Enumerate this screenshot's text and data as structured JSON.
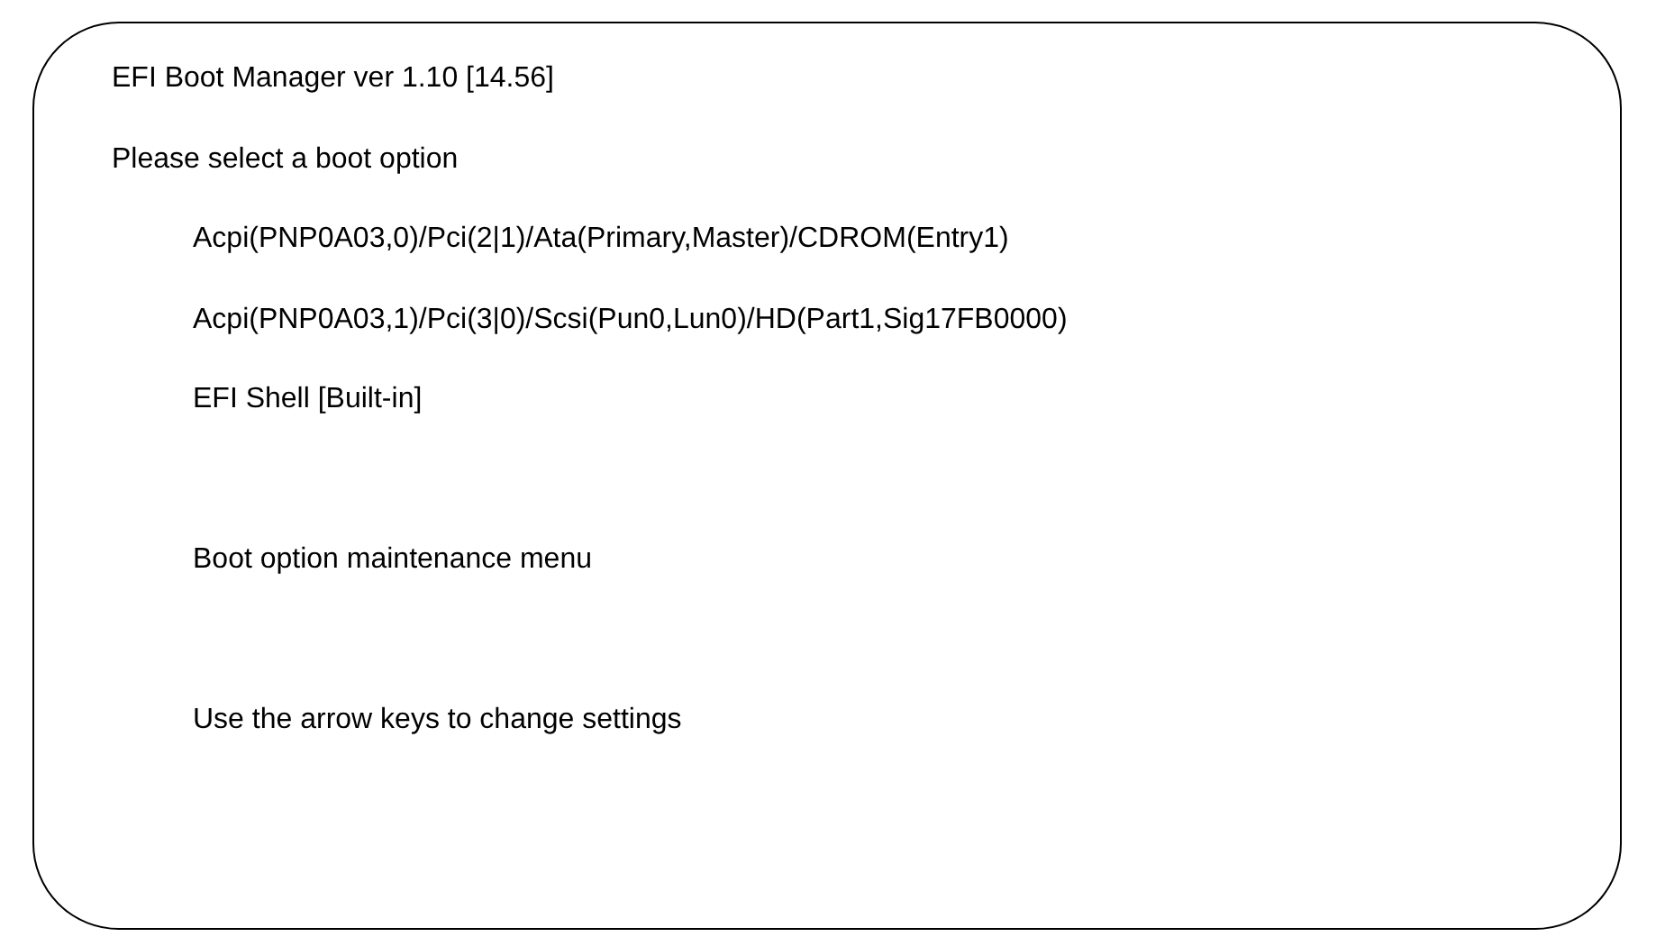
{
  "title": "EFI Boot Manager ver 1.10 [14.56]",
  "prompt": "Please select a boot option",
  "boot_options": [
    {
      "label": "Acpi(PNP0A03,0)/Pci(2|1)/Ata(Primary,Master)/CDROM(Entry1)"
    },
    {
      "label": "Acpi(PNP0A03,1)/Pci(3|0)/Scsi(Pun0,Lun0)/HD(Part1,Sig17FB0000)"
    },
    {
      "label": "EFI Shell [Built-in]"
    }
  ],
  "maintenance": "Boot option maintenance menu",
  "hint": "Use the arrow keys to change settings"
}
